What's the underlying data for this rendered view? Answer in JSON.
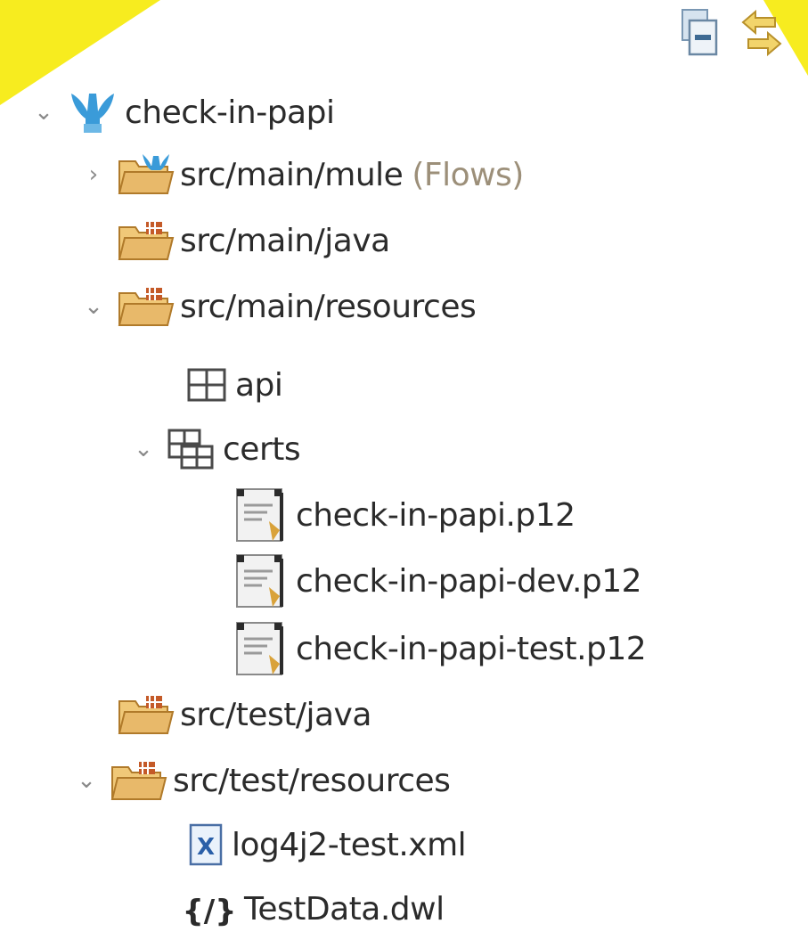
{
  "toolbar": {
    "collapse_all_icon": "collapse-all-icon",
    "link_with_editor_icon": "link-with-editor-icon"
  },
  "tree": {
    "project": {
      "label": "check-in-papi",
      "expanded": true
    },
    "items": [
      {
        "label": "src/main/mule",
        "suffix": "(Flows)",
        "expanded": false,
        "icon": "mule-folder-icon"
      },
      {
        "label": "src/main/java",
        "icon": "source-folder-icon"
      },
      {
        "label": "src/main/resources",
        "expanded": true,
        "icon": "source-folder-icon"
      },
      {
        "label": "api",
        "icon": "package-icon"
      },
      {
        "label": "certs",
        "expanded": true,
        "icon": "package-icon"
      },
      {
        "label": "check-in-papi.p12",
        "icon": "certificate-file-icon"
      },
      {
        "label": "check-in-papi-dev.p12",
        "icon": "certificate-file-icon"
      },
      {
        "label": "check-in-papi-test.p12",
        "icon": "certificate-file-icon"
      },
      {
        "label": "src/test/java",
        "icon": "source-folder-icon"
      },
      {
        "label": "src/test/resources",
        "expanded": true,
        "icon": "source-folder-icon"
      },
      {
        "label": "log4j2-test.xml",
        "icon": "xml-file-icon"
      },
      {
        "label": "TestData.dwl",
        "icon": "dataweave-file-icon"
      }
    ]
  },
  "colors": {
    "folder": "#e8b96a",
    "folder_dark": "#b07a2a",
    "project_blue": "#3a9bd9",
    "twisty": "#8a8a8a",
    "highlight": "#f7ec1f"
  }
}
